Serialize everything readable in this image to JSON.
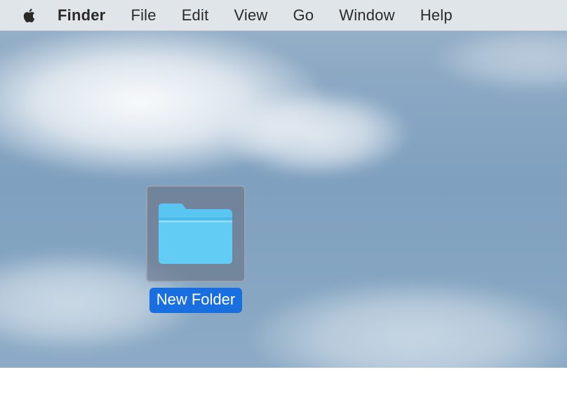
{
  "menubar": {
    "app_name": "Finder",
    "items": [
      "File",
      "Edit",
      "View",
      "Go",
      "Window",
      "Help"
    ]
  },
  "desktop": {
    "items": [
      {
        "name": "New Folder",
        "selected": true
      }
    ]
  }
}
